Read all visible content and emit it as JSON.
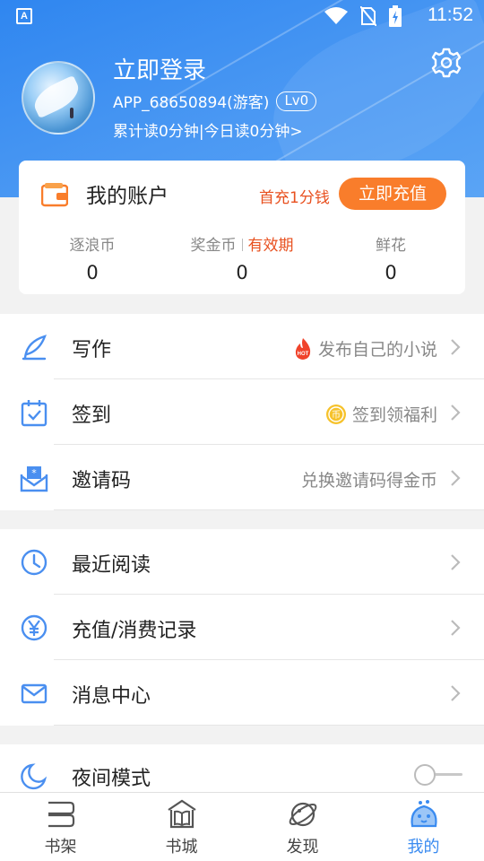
{
  "status_bar": {
    "time": "11:52",
    "notification_icon": "A"
  },
  "profile": {
    "login_title": "立即登录",
    "username": "APP_68650894(游客)",
    "level": "Lv0",
    "reading_stats": "累计读0分钟|今日读0分钟>"
  },
  "account": {
    "title": "我的账户",
    "promo": "首充1分钱",
    "recharge_button": "立即充值",
    "stats": [
      {
        "label": "逐浪币",
        "value": "0"
      },
      {
        "label": "奖金币",
        "extra": "有效期",
        "value": "0"
      },
      {
        "label": "鲜花",
        "value": "0"
      }
    ]
  },
  "menu_group_1": [
    {
      "label": "写作",
      "hint": "发布自己的小说",
      "icon": "feather-pen-icon",
      "badge": "HOT"
    },
    {
      "label": "签到",
      "hint": "签到领福利",
      "icon": "calendar-check-icon",
      "badge_coin": "币"
    },
    {
      "label": "邀请码",
      "hint": "兑换邀请码得金币",
      "icon": "invite-mail-icon"
    }
  ],
  "menu_group_2": [
    {
      "label": "最近阅读",
      "icon": "clock-icon"
    },
    {
      "label": "充值/消费记录",
      "icon": "yen-circle-icon"
    },
    {
      "label": "消息中心",
      "icon": "mail-icon"
    }
  ],
  "night_mode": {
    "label": "夜间模式",
    "enabled": false,
    "icon": "moon-icon"
  },
  "bottom_nav": [
    {
      "label": "书架",
      "icon": "bookshelf-icon"
    },
    {
      "label": "书城",
      "icon": "bookstore-icon"
    },
    {
      "label": "发现",
      "icon": "planet-icon"
    },
    {
      "label": "我的",
      "icon": "mascot-icon",
      "active": true
    }
  ],
  "colors": {
    "primary": "#3a8bf0",
    "accent_orange": "#f97d2b",
    "promo_red": "#e8501f",
    "icon_blue": "#4a8ff0"
  }
}
